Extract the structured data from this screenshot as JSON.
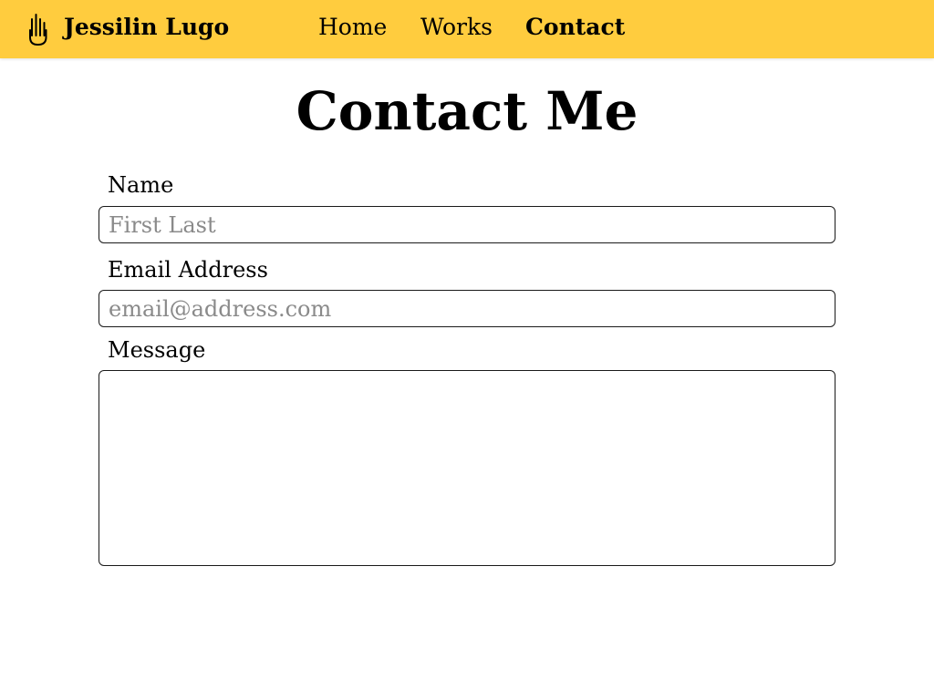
{
  "header": {
    "brand": "Jessilin Lugo",
    "logo_icon": "hand-logo-icon",
    "background_color": "#ffcc3e",
    "nav": [
      {
        "label": "Home",
        "active": false
      },
      {
        "label": "Works",
        "active": false
      },
      {
        "label": "Contact",
        "active": true
      }
    ]
  },
  "main": {
    "title": "Contact Me",
    "form": {
      "name": {
        "label": "Name",
        "placeholder": "First Last",
        "value": ""
      },
      "email": {
        "label": "Email Address",
        "placeholder": "email@address.com",
        "value": ""
      },
      "message": {
        "label": "Message",
        "placeholder": "",
        "value": ""
      }
    }
  }
}
